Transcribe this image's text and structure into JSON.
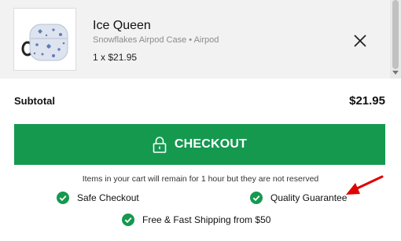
{
  "cart_item": {
    "title": "Ice Queen",
    "variant": "Snowflakes Airpod Case • Airpod",
    "quantity_price": "1 x $21.95",
    "image_icon": "airpod-case-icon"
  },
  "summary": {
    "subtotal_label": "Subtotal",
    "subtotal_value": "$21.95"
  },
  "checkout": {
    "label": "CHECKOUT",
    "color": "#15994f"
  },
  "notice": "Items in your cart will remain for 1 hour but they are not reserved",
  "features": {
    "safe_checkout": "Safe Checkout",
    "quality_guarantee": "Quality Guarantee",
    "free_shipping": "Free & Fast Shipping from $50",
    "check_color": "#15994f"
  },
  "annotation_color": "#e00000"
}
